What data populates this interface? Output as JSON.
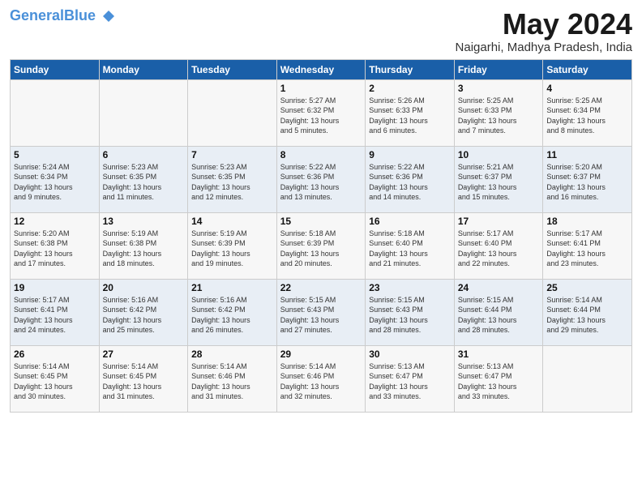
{
  "header": {
    "logo_general": "General",
    "logo_blue": "Blue",
    "month_year": "May 2024",
    "location": "Naigarhi, Madhya Pradesh, India"
  },
  "days_of_week": [
    "Sunday",
    "Monday",
    "Tuesday",
    "Wednesday",
    "Thursday",
    "Friday",
    "Saturday"
  ],
  "weeks": [
    [
      {
        "day": "",
        "text": ""
      },
      {
        "day": "",
        "text": ""
      },
      {
        "day": "",
        "text": ""
      },
      {
        "day": "1",
        "text": "Sunrise: 5:27 AM\nSunset: 6:32 PM\nDaylight: 13 hours\nand 5 minutes."
      },
      {
        "day": "2",
        "text": "Sunrise: 5:26 AM\nSunset: 6:33 PM\nDaylight: 13 hours\nand 6 minutes."
      },
      {
        "day": "3",
        "text": "Sunrise: 5:25 AM\nSunset: 6:33 PM\nDaylight: 13 hours\nand 7 minutes."
      },
      {
        "day": "4",
        "text": "Sunrise: 5:25 AM\nSunset: 6:34 PM\nDaylight: 13 hours\nand 8 minutes."
      }
    ],
    [
      {
        "day": "5",
        "text": "Sunrise: 5:24 AM\nSunset: 6:34 PM\nDaylight: 13 hours\nand 9 minutes."
      },
      {
        "day": "6",
        "text": "Sunrise: 5:23 AM\nSunset: 6:35 PM\nDaylight: 13 hours\nand 11 minutes."
      },
      {
        "day": "7",
        "text": "Sunrise: 5:23 AM\nSunset: 6:35 PM\nDaylight: 13 hours\nand 12 minutes."
      },
      {
        "day": "8",
        "text": "Sunrise: 5:22 AM\nSunset: 6:36 PM\nDaylight: 13 hours\nand 13 minutes."
      },
      {
        "day": "9",
        "text": "Sunrise: 5:22 AM\nSunset: 6:36 PM\nDaylight: 13 hours\nand 14 minutes."
      },
      {
        "day": "10",
        "text": "Sunrise: 5:21 AM\nSunset: 6:37 PM\nDaylight: 13 hours\nand 15 minutes."
      },
      {
        "day": "11",
        "text": "Sunrise: 5:20 AM\nSunset: 6:37 PM\nDaylight: 13 hours\nand 16 minutes."
      }
    ],
    [
      {
        "day": "12",
        "text": "Sunrise: 5:20 AM\nSunset: 6:38 PM\nDaylight: 13 hours\nand 17 minutes."
      },
      {
        "day": "13",
        "text": "Sunrise: 5:19 AM\nSunset: 6:38 PM\nDaylight: 13 hours\nand 18 minutes."
      },
      {
        "day": "14",
        "text": "Sunrise: 5:19 AM\nSunset: 6:39 PM\nDaylight: 13 hours\nand 19 minutes."
      },
      {
        "day": "15",
        "text": "Sunrise: 5:18 AM\nSunset: 6:39 PM\nDaylight: 13 hours\nand 20 minutes."
      },
      {
        "day": "16",
        "text": "Sunrise: 5:18 AM\nSunset: 6:40 PM\nDaylight: 13 hours\nand 21 minutes."
      },
      {
        "day": "17",
        "text": "Sunrise: 5:17 AM\nSunset: 6:40 PM\nDaylight: 13 hours\nand 22 minutes."
      },
      {
        "day": "18",
        "text": "Sunrise: 5:17 AM\nSunset: 6:41 PM\nDaylight: 13 hours\nand 23 minutes."
      }
    ],
    [
      {
        "day": "19",
        "text": "Sunrise: 5:17 AM\nSunset: 6:41 PM\nDaylight: 13 hours\nand 24 minutes."
      },
      {
        "day": "20",
        "text": "Sunrise: 5:16 AM\nSunset: 6:42 PM\nDaylight: 13 hours\nand 25 minutes."
      },
      {
        "day": "21",
        "text": "Sunrise: 5:16 AM\nSunset: 6:42 PM\nDaylight: 13 hours\nand 26 minutes."
      },
      {
        "day": "22",
        "text": "Sunrise: 5:15 AM\nSunset: 6:43 PM\nDaylight: 13 hours\nand 27 minutes."
      },
      {
        "day": "23",
        "text": "Sunrise: 5:15 AM\nSunset: 6:43 PM\nDaylight: 13 hours\nand 28 minutes."
      },
      {
        "day": "24",
        "text": "Sunrise: 5:15 AM\nSunset: 6:44 PM\nDaylight: 13 hours\nand 28 minutes."
      },
      {
        "day": "25",
        "text": "Sunrise: 5:14 AM\nSunset: 6:44 PM\nDaylight: 13 hours\nand 29 minutes."
      }
    ],
    [
      {
        "day": "26",
        "text": "Sunrise: 5:14 AM\nSunset: 6:45 PM\nDaylight: 13 hours\nand 30 minutes."
      },
      {
        "day": "27",
        "text": "Sunrise: 5:14 AM\nSunset: 6:45 PM\nDaylight: 13 hours\nand 31 minutes."
      },
      {
        "day": "28",
        "text": "Sunrise: 5:14 AM\nSunset: 6:46 PM\nDaylight: 13 hours\nand 31 minutes."
      },
      {
        "day": "29",
        "text": "Sunrise: 5:14 AM\nSunset: 6:46 PM\nDaylight: 13 hours\nand 32 minutes."
      },
      {
        "day": "30",
        "text": "Sunrise: 5:13 AM\nSunset: 6:47 PM\nDaylight: 13 hours\nand 33 minutes."
      },
      {
        "day": "31",
        "text": "Sunrise: 5:13 AM\nSunset: 6:47 PM\nDaylight: 13 hours\nand 33 minutes."
      },
      {
        "day": "",
        "text": ""
      }
    ]
  ]
}
